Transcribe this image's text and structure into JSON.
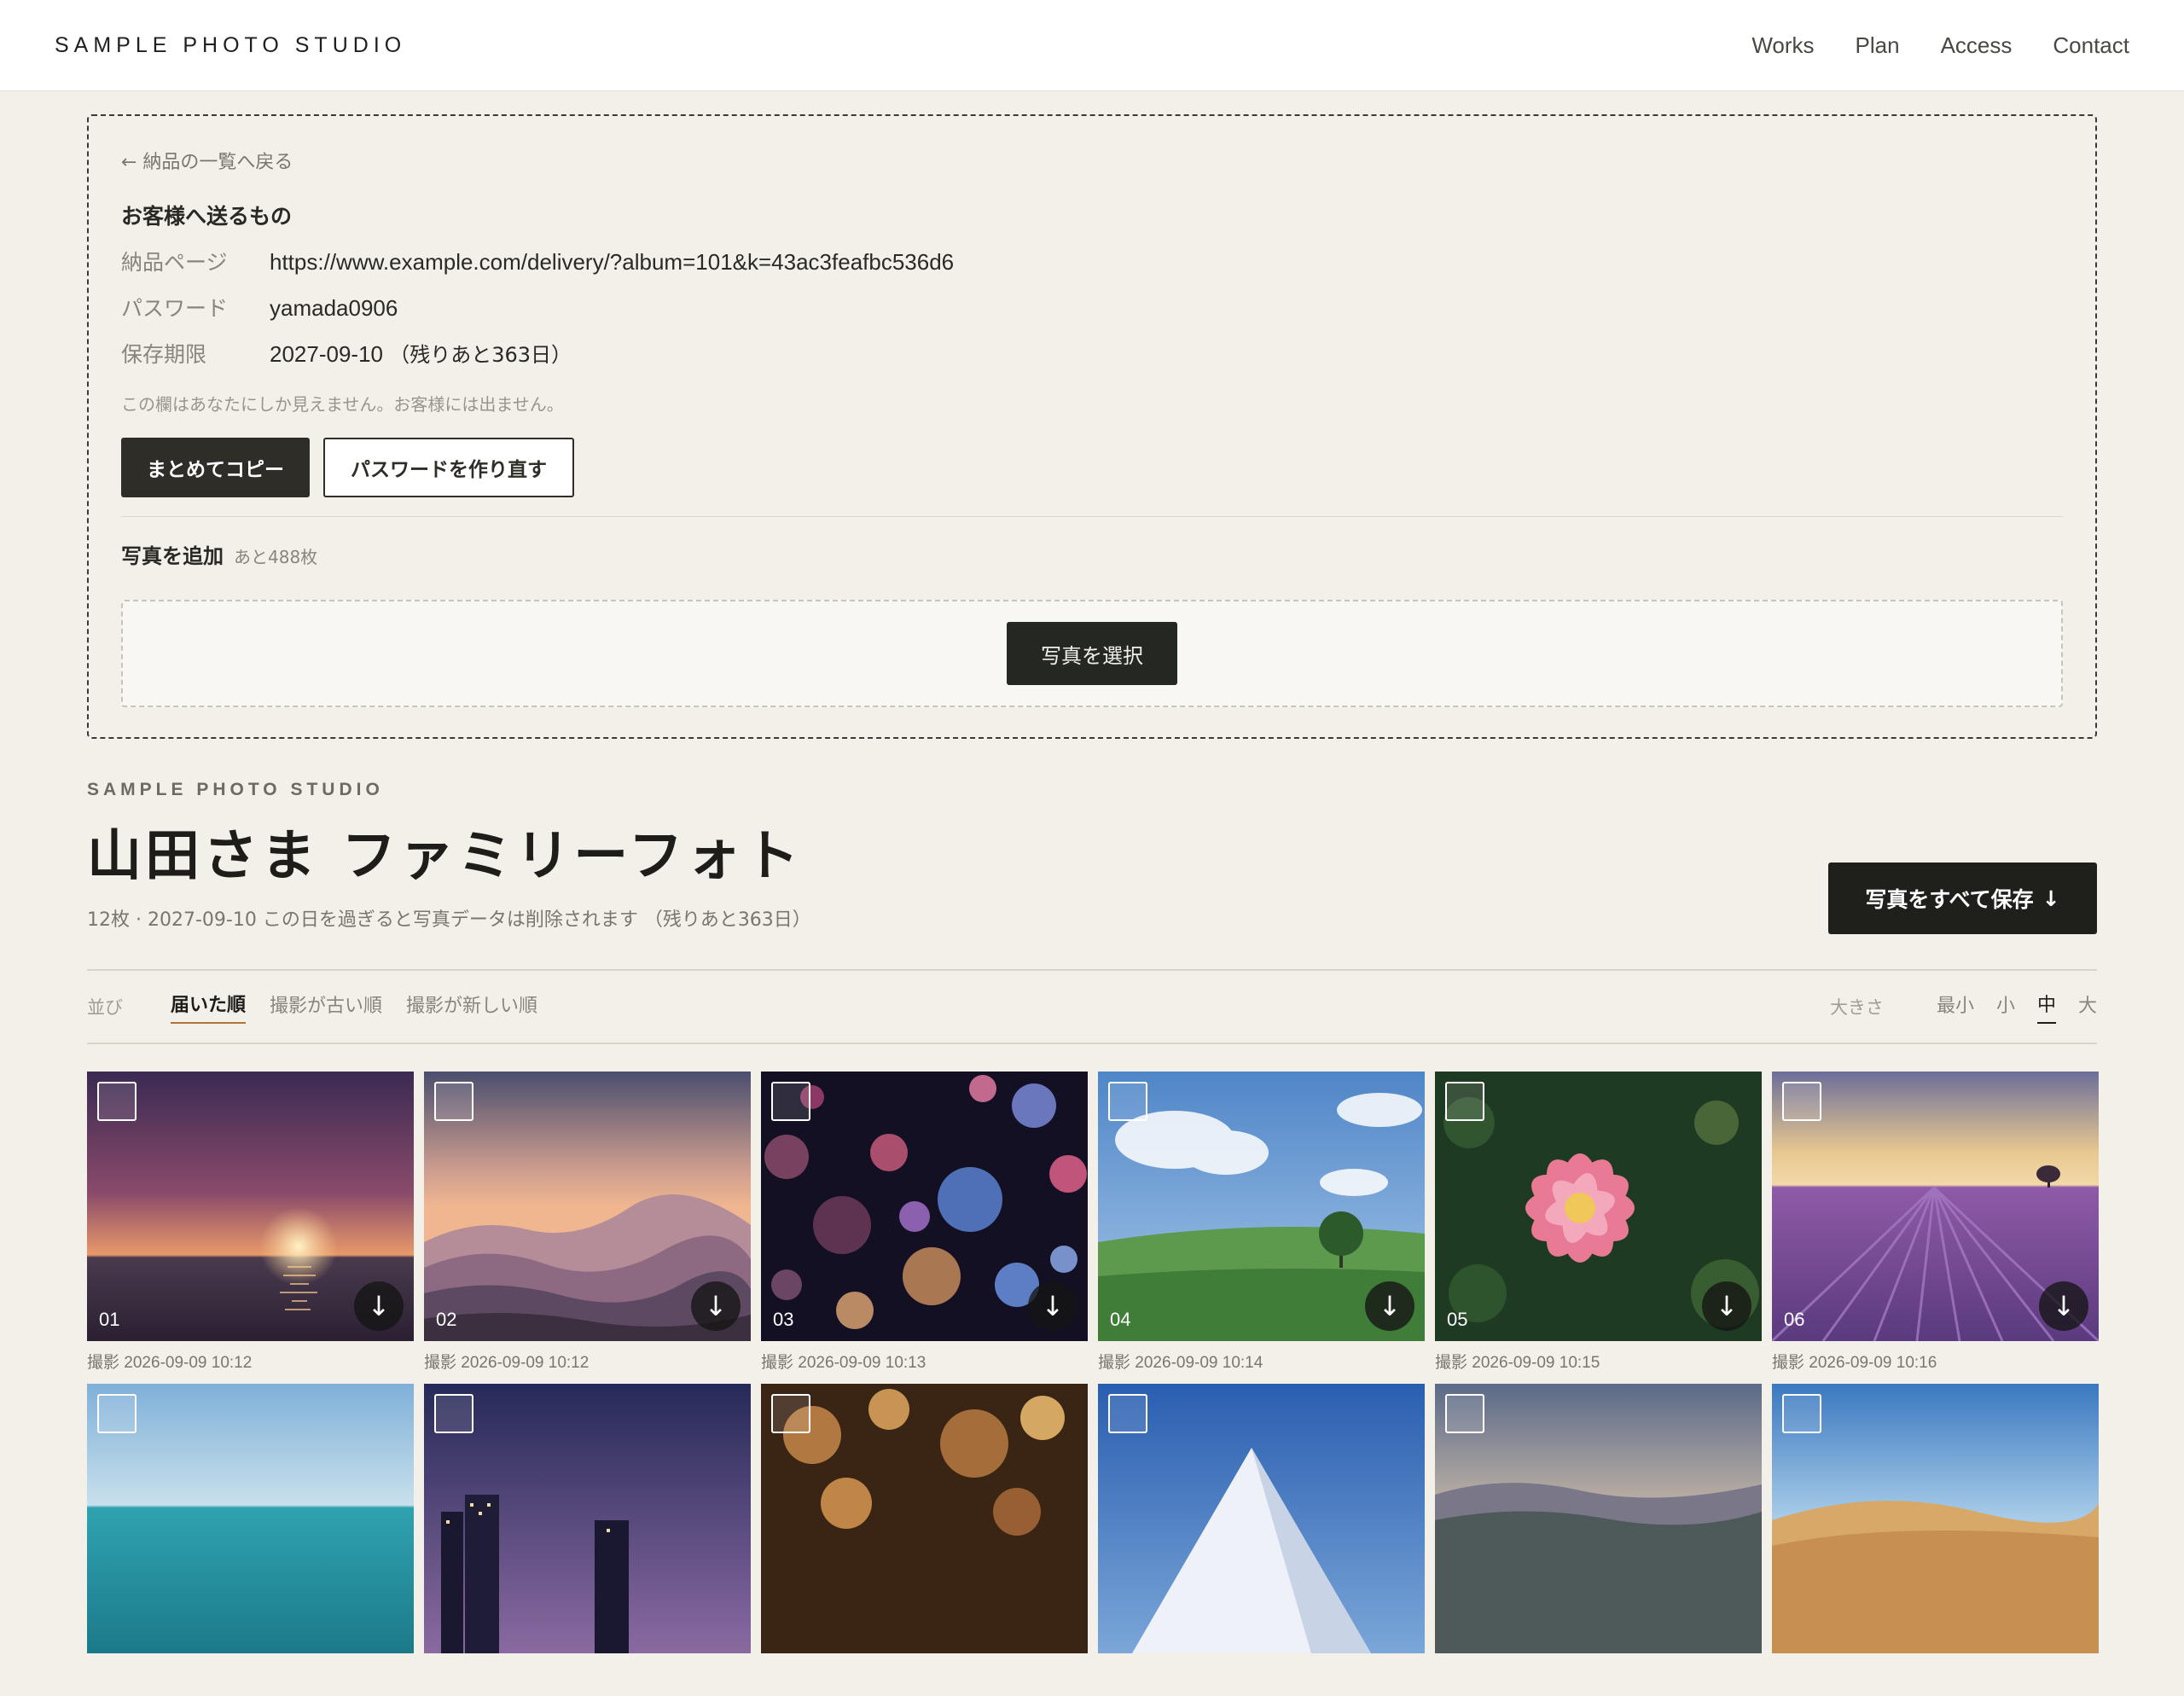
{
  "header": {
    "brand": "SAMPLE PHOTO STUDIO",
    "nav": [
      "Works",
      "Plan",
      "Access",
      "Contact"
    ]
  },
  "panel": {
    "back": "← 納品の一覧へ戻る",
    "title": "お客様へ送るもの",
    "rows": [
      {
        "key": "納品ページ",
        "value": "https://www.example.com/delivery/?album=101&k=43ac3feafbc536d6"
      },
      {
        "key": "パスワード",
        "value": "yamada0906"
      },
      {
        "key": "保存期限",
        "value": "2027-09-10",
        "extra": "（残りあと363日）"
      }
    ],
    "note": "この欄はあなたにしか見えません。お客様には出ません。",
    "copy_all": "まとめてコピー",
    "regen_password": "パスワードを作り直す",
    "add_title": "写真を追加",
    "add_remaining": "あと488枚",
    "select_photos": "写真を選択"
  },
  "album": {
    "studio": "SAMPLE PHOTO STUDIO",
    "title": "山田さま ファミリーフォト",
    "meta": "12枚 · 2027-09-10 この日を過ぎると写真データは削除されます （残りあと363日）",
    "save_all": "写真をすべて保存",
    "save_all_icon": "↓"
  },
  "toolbar": {
    "sort_label": "並び",
    "sort_options": [
      "届いた順",
      "撮影が古い順",
      "撮影が新しい順"
    ],
    "size_label": "大きさ",
    "size_options": [
      "最小",
      "小",
      "中",
      "大"
    ]
  },
  "photos": [
    {
      "num": "01",
      "shot_prefix": "撮影",
      "shot": "2026-09-09 10:12"
    },
    {
      "num": "02",
      "shot_prefix": "撮影",
      "shot": "2026-09-09 10:12"
    },
    {
      "num": "03",
      "shot_prefix": "撮影",
      "shot": "2026-09-09 10:13"
    },
    {
      "num": "04",
      "shot_prefix": "撮影",
      "shot": "2026-09-09 10:14"
    },
    {
      "num": "05",
      "shot_prefix": "撮影",
      "shot": "2026-09-09 10:15"
    },
    {
      "num": "06",
      "shot_prefix": "撮影",
      "shot": "2026-09-09 10:16"
    }
  ],
  "download_icon": "↓"
}
